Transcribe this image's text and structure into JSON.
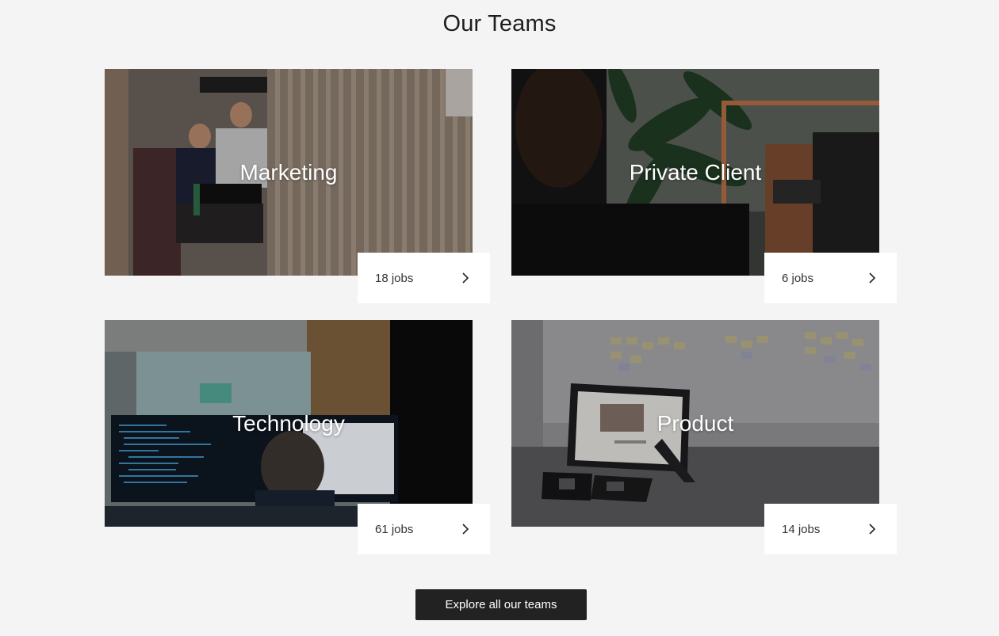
{
  "section": {
    "title": "Our Teams"
  },
  "teams": [
    {
      "name": "Marketing",
      "jobs": "18 jobs",
      "image": "two-men-working-on-laptops-photo"
    },
    {
      "name": "Private Client",
      "jobs": "6 jobs",
      "image": "man-browsing-clothing-rack-photo"
    },
    {
      "name": "Technology",
      "jobs": "61 jobs",
      "image": "developer-at-monitors-photo"
    },
    {
      "name": "Product",
      "jobs": "14 jobs",
      "image": "tablet-and-phones-on-table-photo"
    }
  ],
  "cta": {
    "label": "Explore all our teams"
  },
  "icons": {
    "jobs_arrow": "chevron-right-icon"
  },
  "colors": {
    "background": "#f4f4f4",
    "button_bg": "#222222",
    "button_text": "#ffffff",
    "card_overlay_text": "#ffffff"
  }
}
